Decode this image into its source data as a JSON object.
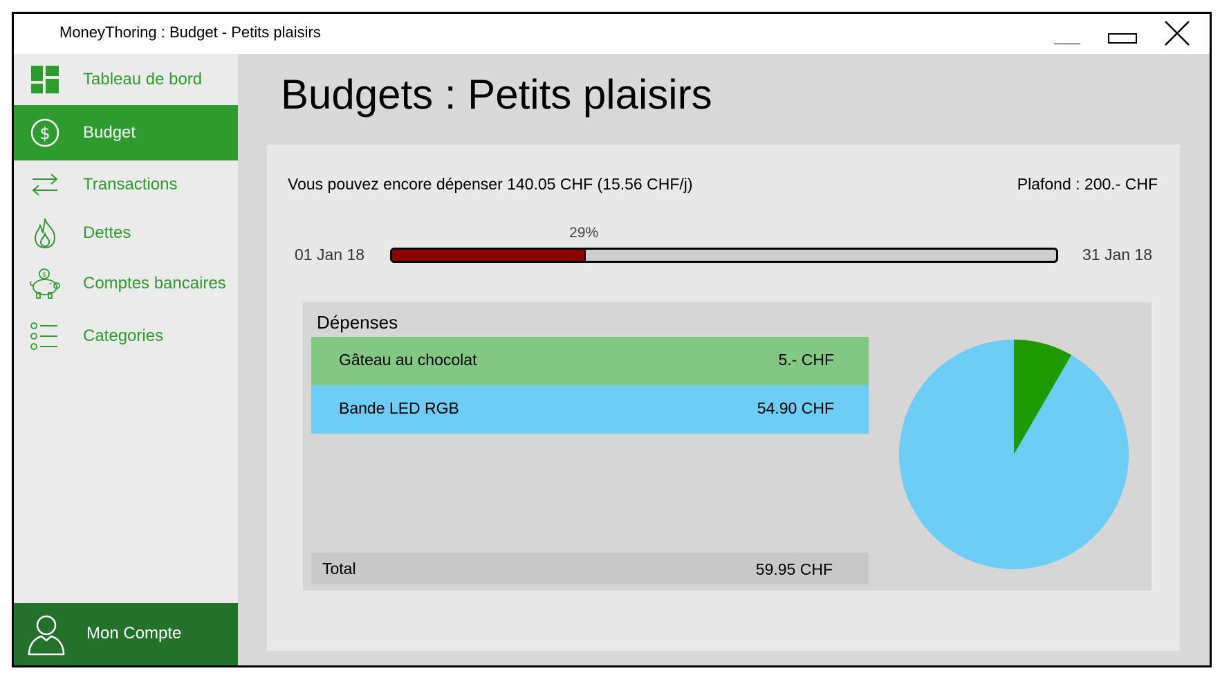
{
  "window": {
    "title": "MoneyThoring : Budget - Petits plaisirs"
  },
  "sidebar": {
    "items": [
      {
        "label": "Tableau de bord",
        "icon": "dashboard-icon",
        "active": false
      },
      {
        "label": "Budget",
        "icon": "dollar-circle-icon",
        "active": true
      },
      {
        "label": "Transactions",
        "icon": "transfer-arrows-icon",
        "active": false
      },
      {
        "label": "Dettes",
        "icon": "flame-icon",
        "active": false
      },
      {
        "label": "Comptes bancaires",
        "icon": "piggy-bank-icon",
        "active": false
      },
      {
        "label": "Categories",
        "icon": "list-icon",
        "active": false
      }
    ],
    "account": {
      "label": "Mon Compte",
      "icon": "user-icon"
    }
  },
  "main": {
    "title": "Budgets : Petits plaisirs",
    "remaining": "Vous pouvez encore dépenser 140.05 CHF (15.56 CHF/j)",
    "ceiling": "Plafond : 200.- CHF",
    "period": {
      "start": "01 Jan 18",
      "end": "31 Jan 18",
      "progress_percent": 29,
      "progress_label": "29%"
    },
    "expenses": {
      "title": "Dépenses",
      "items": [
        {
          "name": "Gâteau au chocolat",
          "amount": "5.- CHF",
          "value": 5,
          "color": "#82c882"
        },
        {
          "name": "Bande LED RGB",
          "amount": "54.90 CHF",
          "value": 54.9,
          "color": "#6dcdf5"
        }
      ],
      "total_label": "Total",
      "total_value": "59.95 CHF"
    }
  },
  "colors": {
    "accent": "#2e9b2e",
    "accent_dark": "#23712a",
    "progress_fill": "#8b0000",
    "pie_green": "#1f9a00",
    "pie_blue": "#6dcdf5"
  }
}
